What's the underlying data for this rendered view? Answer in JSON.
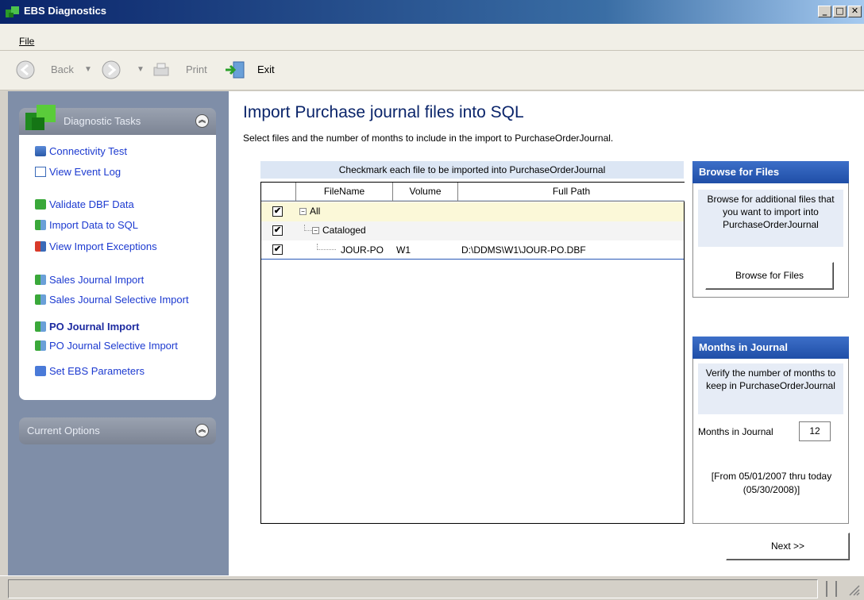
{
  "window": {
    "title": "EBS Diagnostics"
  },
  "menu": {
    "file": "File"
  },
  "toolbar": {
    "back": "Back",
    "print": "Print",
    "exit": "Exit"
  },
  "sidebar": {
    "tasks_title": "Diagnostic Tasks",
    "options_title": "Current Options",
    "items": [
      {
        "label": "Connectivity Test",
        "icon": "network-icon"
      },
      {
        "label": "View Event Log",
        "icon": "log-icon"
      },
      {
        "label": "Validate DBF Data",
        "icon": "validate-icon"
      },
      {
        "label": "Import Data to SQL",
        "icon": "import-icon"
      },
      {
        "label": "View Import Exceptions",
        "icon": "exceptions-icon"
      },
      {
        "label": "Sales Journal Import",
        "icon": "import-icon"
      },
      {
        "label": "Sales Journal Selective Import",
        "icon": "import-icon"
      },
      {
        "label": "PO Journal Import",
        "icon": "import-icon",
        "active": true
      },
      {
        "label": "PO Journal Selective Import",
        "icon": "import-icon"
      },
      {
        "label": "Set EBS Parameters",
        "icon": "parameters-icon"
      }
    ]
  },
  "main": {
    "heading": "Import Purchase journal files into SQL",
    "subheading": "Select files and the number of months to include in the import to PurchaseOrderJournal.",
    "grid_caption": "Checkmark each file to be imported into PurchaseOrderJournal",
    "columns": [
      "FileName",
      "Volume",
      "Full Path"
    ],
    "rows": [
      {
        "name": "All",
        "volume": "",
        "path": "",
        "checked": "✔"
      },
      {
        "name": "Cataloged",
        "volume": "",
        "path": "",
        "checked": "✔"
      },
      {
        "name": "JOUR-PO",
        "volume": "W1",
        "path": "D:\\DDMS\\W1\\JOUR-PO.DBF",
        "checked": "✔"
      }
    ],
    "tree_toggle": "−"
  },
  "browse": {
    "title": "Browse for Files",
    "note": "Browse for additional files that you want to import into PurchaseOrderJournal",
    "button": "Browse for Files"
  },
  "months": {
    "title": "Months in Journal",
    "note": "Verify the number of months to keep in PurchaseOrderJournal",
    "label": "Months in Journal",
    "value": "12",
    "range": "[From 05/01/2007 thru today (05/30/2008)]"
  },
  "next_button": "Next >>",
  "colors": {
    "accent": "#1f4ea7",
    "link": "#1c3ad0",
    "title_bar": "#0a246a"
  }
}
